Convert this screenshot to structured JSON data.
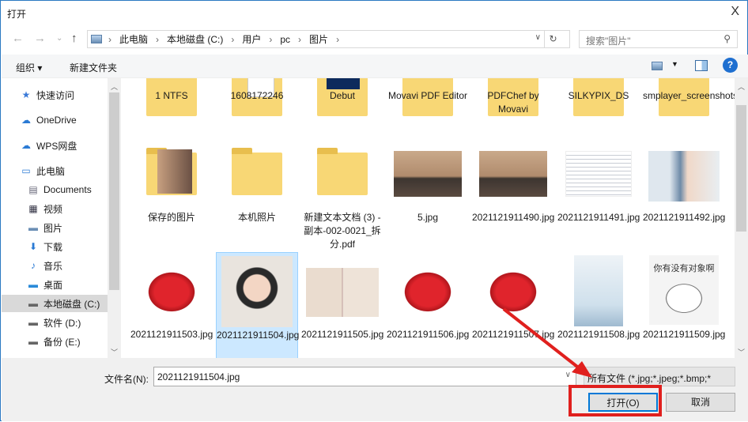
{
  "window": {
    "title": "打开",
    "close": "X"
  },
  "nav": {
    "back": "←",
    "forward": "→",
    "recent": "⌄",
    "up": "↑",
    "breadcrumb": [
      "此电脑",
      "本地磁盘 (C:)",
      "用户",
      "pc",
      "图片"
    ],
    "search_placeholder": "搜索\"图片\""
  },
  "toolbar": {
    "organize": "组织 ▾",
    "new_folder": "新建文件夹"
  },
  "sidebar": {
    "items": [
      {
        "label": "快速访问",
        "icon": "star-icon",
        "indent": 0
      },
      {
        "label": "OneDrive",
        "icon": "cloud-icon",
        "indent": 0
      },
      {
        "label": "WPS网盘",
        "icon": "cloud-icon",
        "indent": 0
      },
      {
        "label": "此电脑",
        "icon": "computer-icon",
        "indent": 0
      },
      {
        "label": "Documents",
        "icon": "document-icon",
        "indent": 1
      },
      {
        "label": "视频",
        "icon": "video-icon",
        "indent": 1
      },
      {
        "label": "图片",
        "icon": "picture-icon",
        "indent": 1
      },
      {
        "label": "下载",
        "icon": "download-icon",
        "indent": 1
      },
      {
        "label": "音乐",
        "icon": "music-icon",
        "indent": 1
      },
      {
        "label": "桌面",
        "icon": "desktop-icon",
        "indent": 1
      },
      {
        "label": "本地磁盘 (C:)",
        "icon": "drive-icon",
        "indent": 1,
        "selected": true
      },
      {
        "label": "软件 (D:)",
        "icon": "drive-icon",
        "indent": 1
      },
      {
        "label": "备份 (E:)",
        "icon": "drive-icon",
        "indent": 1
      }
    ]
  },
  "files": [
    {
      "name": "1 NTFS",
      "type": "folder"
    },
    {
      "name": "1608172246",
      "type": "folder-doc"
    },
    {
      "name": "Debut",
      "type": "folder-dark"
    },
    {
      "name": "Movavi PDF Editor",
      "type": "folder"
    },
    {
      "name": "PDFChef by Movavi",
      "type": "folder"
    },
    {
      "name": "SILKYPIX_DS",
      "type": "folder"
    },
    {
      "name": "smplayer_screenshots",
      "type": "folder"
    },
    {
      "name": "保存的图片",
      "type": "folder-photo"
    },
    {
      "name": "本机照片",
      "type": "folder"
    },
    {
      "name": "新建文本文档 (3) - 副本-002-0021_拆分.pdf",
      "type": "folder"
    },
    {
      "name": "5.jpg",
      "type": "fog"
    },
    {
      "name": "2021121911490.jpg",
      "type": "fog"
    },
    {
      "name": "2021121911491.jpg",
      "type": "doc"
    },
    {
      "name": "2021121911492.jpg",
      "type": "boy"
    },
    {
      "name": "2021121911503.jpg",
      "type": "strawberry"
    },
    {
      "name": "2021121911504.jpg",
      "type": "girl",
      "selected": true
    },
    {
      "name": "2021121911505.jpg",
      "type": "passport"
    },
    {
      "name": "2021121911506.jpg",
      "type": "strawberry"
    },
    {
      "name": "2021121911507.jpg",
      "type": "strawberry"
    },
    {
      "name": "2021121911508.jpg",
      "type": "poster"
    },
    {
      "name": "2021121911509.jpg",
      "type": "hamster",
      "caption": "你有没有对象啊"
    }
  ],
  "bottom": {
    "filename_label": "文件名(N):",
    "filename_value": "2021121911504.jpg",
    "filetype": "所有文件 (*.jpg;*.jpeg;*.bmp;*",
    "open": "打开(O)",
    "cancel": "取消"
  },
  "colors": {
    "accent": "#0078d7",
    "annotation": "#e0201e",
    "selection": "#cce8ff"
  }
}
